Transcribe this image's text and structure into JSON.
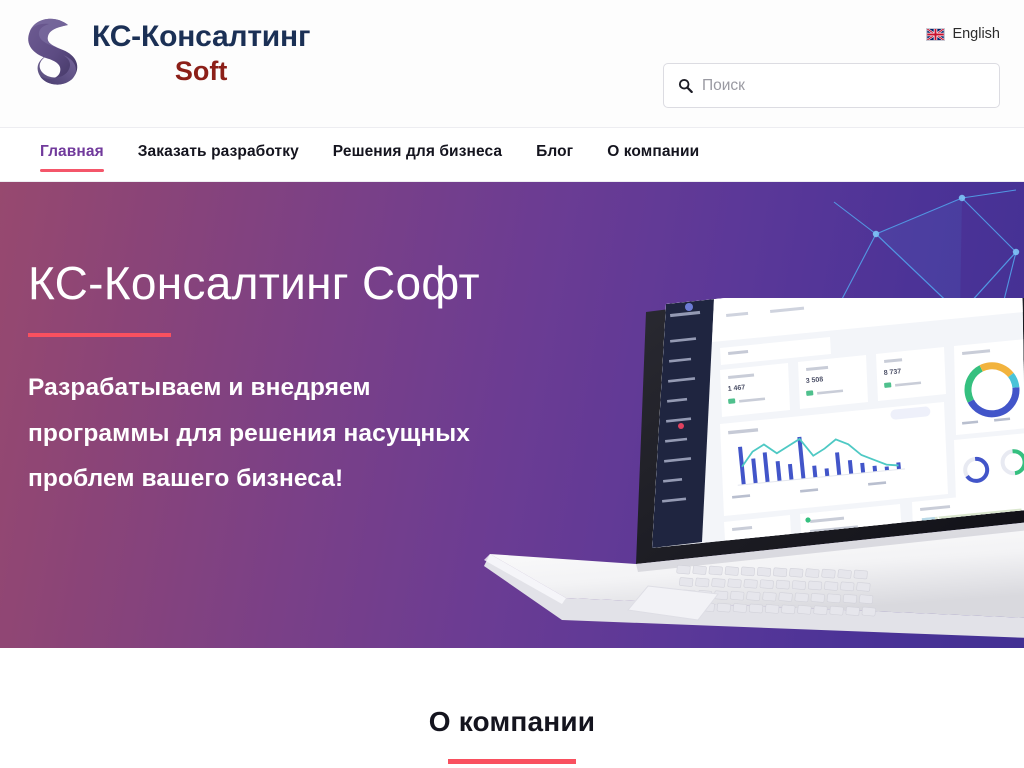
{
  "brand": {
    "name": "КС-Консалтинг",
    "sub": "Soft",
    "logo_icon": "swirl-s-logo",
    "name_color": "#1b3055",
    "sub_color": "#8c1f18"
  },
  "header": {
    "language": {
      "label": "English",
      "flag_icon": "uk-flag-icon"
    },
    "search": {
      "placeholder": "Поиск",
      "value": "",
      "icon": "search-icon"
    }
  },
  "nav": {
    "items": [
      {
        "label": "Главная",
        "active": true
      },
      {
        "label": "Заказать разработку",
        "active": false
      },
      {
        "label": "Решения для бизнеса",
        "active": false
      },
      {
        "label": "Блог",
        "active": false
      },
      {
        "label": "О компании",
        "active": false
      }
    ],
    "active_color": "#713a9c",
    "underline_color": "#f4566a"
  },
  "hero": {
    "title": "КС-Консалтинг Софт",
    "subtitle_lines": [
      "Разрабатываем и внедряем",
      "программы для решения насущных",
      "проблем вашего бизнеса!"
    ],
    "accent_color": "#f9505f",
    "gradient_from": "#97496f",
    "gradient_to": "#423093",
    "graphic": "laptop-dashboard-image",
    "decor": "blue-network-polygons"
  },
  "section": {
    "title": "О компании",
    "accent_color": "#f9505f"
  }
}
